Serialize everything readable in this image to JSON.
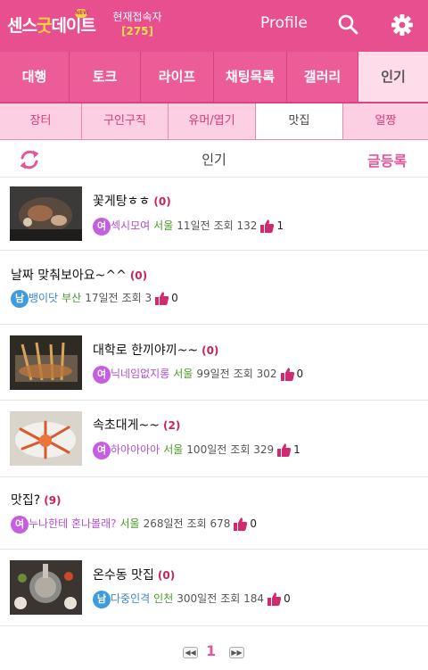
{
  "header": {
    "logo_a": "센스",
    "logo_b": "굿",
    "logo_c": "데이트",
    "logo_badge": "NEW",
    "online_label": "현재접속자",
    "online_count": "[275]",
    "profile_label": "Profile",
    "search_icon": "search-icon",
    "settings_icon": "gear-icon"
  },
  "main_tabs": [
    {
      "label": "대행"
    },
    {
      "label": "토크"
    },
    {
      "label": "라이프"
    },
    {
      "label": "채팅목록"
    },
    {
      "label": "갤러리"
    },
    {
      "label": "인기"
    }
  ],
  "sub_tabs": [
    {
      "label": "장터"
    },
    {
      "label": "구인구직"
    },
    {
      "label": "유머/엽기"
    },
    {
      "label": "맛집"
    },
    {
      "label": "얼짱"
    }
  ],
  "titlebar": {
    "title": "인기",
    "write_label": "글등록"
  },
  "posts": [
    {
      "title": "꽃게탕ㅎㅎ",
      "comments": "(0)",
      "gender": "여",
      "nick": "섹시모여",
      "region": "서울",
      "date": "11일전",
      "views": "조회 132",
      "likes": "1"
    },
    {
      "title": "날짜 맞춰보아요~^^",
      "comments": "(0)",
      "gender": "남",
      "nick": "뱅이닷",
      "region": "부산",
      "date": "17일전",
      "views": "조회 3",
      "likes": "0"
    },
    {
      "title": "대학로 한끼야끼~~",
      "comments": "(0)",
      "gender": "여",
      "nick": "닉네임없지롱",
      "region": "서울",
      "date": "99일전",
      "views": "조회 302",
      "likes": "0"
    },
    {
      "title": "속초대게~~",
      "comments": "(2)",
      "gender": "여",
      "nick": "하아아아아",
      "region": "서울",
      "date": "100일전",
      "views": "조회 329",
      "likes": "1"
    },
    {
      "title": "맛집?",
      "comments": "(9)",
      "gender": "여",
      "nick": "누나한테 혼나볼래?",
      "region": "서울",
      "date": "268일전",
      "views": "조회 678",
      "likes": "0"
    },
    {
      "title": "온수동 맛집",
      "comments": "(0)",
      "gender": "남",
      "nick": "다중인격",
      "region": "인천",
      "date": "300일전",
      "views": "조회 184",
      "likes": "0"
    }
  ],
  "pager": {
    "prev": "◀◀",
    "current": "1",
    "next": "▶▶"
  },
  "colors": {
    "brand": "#e84f8f",
    "accent": "#e2569a",
    "female": "#c55ee0",
    "male": "#3e9be0"
  }
}
